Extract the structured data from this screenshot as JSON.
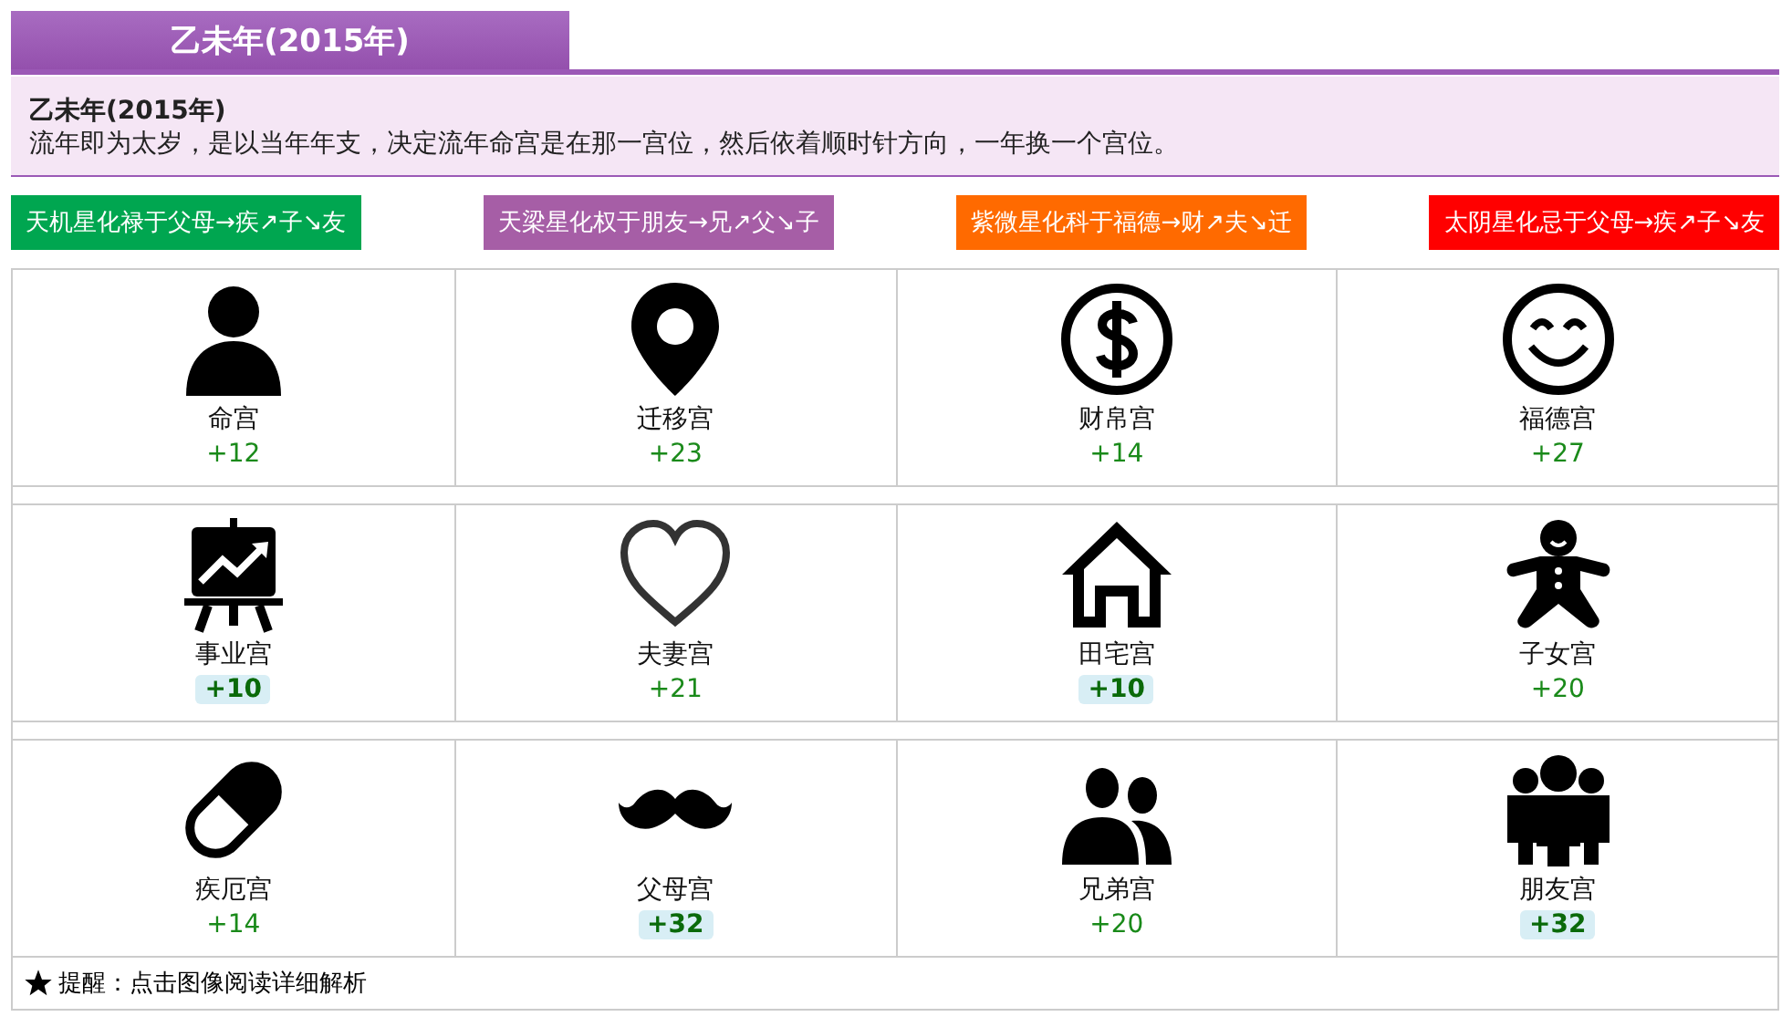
{
  "header_tab": {
    "title": "乙未年(2015年)"
  },
  "info": {
    "title": "乙未年(2015年)",
    "description": "流年即为太岁，是以当年年支，决定流年命宫是在那一宫位，然后依着顺时针方向，一年换一个宫位。"
  },
  "tags": [
    {
      "label": "天机星化禄于父母→疾↗子↘友",
      "color": "#00a650"
    },
    {
      "label": "天梁星化权于朋友→兄↗父↘子",
      "color": "#a65ea6"
    },
    {
      "label": "紫微星化科于福德→财↗夫↘迁",
      "color": "#ff6a00"
    },
    {
      "label": "太阴星化忌于父母→疾↗子↘友",
      "color": "#ff0000"
    }
  ],
  "rows": [
    {
      "cells": [
        {
          "name": "命宫",
          "score": "+12",
          "highlighted": false
        },
        {
          "name": "迁移宫",
          "score": "+23",
          "highlighted": false
        },
        {
          "name": "财帛宫",
          "score": "+14",
          "highlighted": false
        },
        {
          "name": "福德宫",
          "score": "+27",
          "highlighted": false
        }
      ]
    },
    {
      "cells": [
        {
          "name": "事业宫",
          "score": "+10",
          "highlighted": true
        },
        {
          "name": "夫妻宫",
          "score": "+21",
          "highlighted": false
        },
        {
          "name": "田宅宫",
          "score": "+10",
          "highlighted": true
        },
        {
          "name": "子女宫",
          "score": "+20",
          "highlighted": false
        }
      ]
    },
    {
      "cells": [
        {
          "name": "疾厄宫",
          "score": "+14",
          "highlighted": false
        },
        {
          "name": "父母宫",
          "score": "+32",
          "highlighted": true
        },
        {
          "name": "兄弟宫",
          "score": "+20",
          "highlighted": false
        },
        {
          "name": "朋友宫",
          "score": "+32",
          "highlighted": true
        }
      ]
    }
  ],
  "footer": {
    "text": "提醒：点击图像阅读详细解析"
  }
}
